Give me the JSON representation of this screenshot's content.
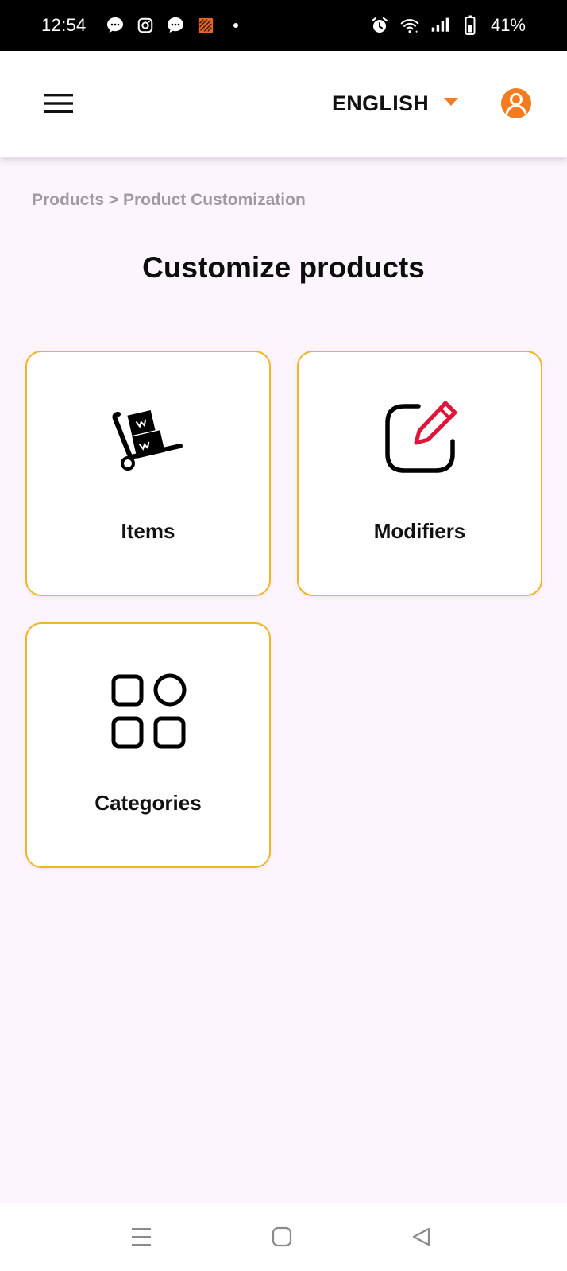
{
  "status_bar": {
    "time": "12:54",
    "battery_percent": "41%",
    "left_icons": [
      "chat-bubble-icon",
      "instagram-icon",
      "chat-bubble-icon",
      "app-notification-icon",
      "more-dot-icon"
    ],
    "right_icons": [
      "alarm-icon",
      "wifi-icon",
      "signal-icon",
      "battery-icon"
    ]
  },
  "header": {
    "menu_icon": "hamburger-menu-icon",
    "language": "ENGLISH",
    "language_caret_icon": "caret-down-icon",
    "profile_icon": "user-avatar-icon",
    "accent_color": "#f47c20"
  },
  "breadcrumb": "Products > Product Customization",
  "page_title": "Customize products",
  "cards": [
    {
      "label": "Items",
      "icon": "hand-truck-boxes-icon"
    },
    {
      "label": "Modifiers",
      "icon": "edit-square-icon"
    },
    {
      "label": "Categories",
      "icon": "categories-grid-icon"
    }
  ],
  "card_border_color": "#f0b429",
  "nav_bar": {
    "icons": [
      "recent-apps-icon",
      "home-icon",
      "back-icon"
    ]
  }
}
